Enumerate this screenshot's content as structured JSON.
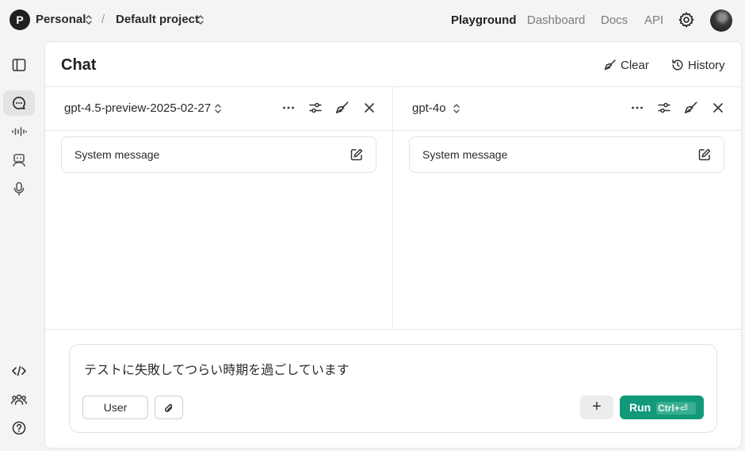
{
  "header": {
    "org_initial": "P",
    "org_name": "Personal",
    "project_name": "Default project",
    "separator": "/",
    "nav": [
      {
        "label": "Playground",
        "active": true
      },
      {
        "label": "Dashboard",
        "active": false
      },
      {
        "label": "Docs",
        "active": false
      },
      {
        "label": "API",
        "active": false
      }
    ],
    "settings_icon": "gear-icon",
    "avatar": "user-avatar"
  },
  "sidebar": {
    "top_items": [
      {
        "icon": "sidebar-toggle-icon"
      },
      {
        "icon": "chat-icon",
        "active": true
      },
      {
        "icon": "audio-waveform-icon"
      },
      {
        "icon": "assistant-robot-icon"
      },
      {
        "icon": "microphone-icon"
      }
    ],
    "bottom_items": [
      {
        "icon": "code-icon"
      },
      {
        "icon": "team-icon"
      },
      {
        "icon": "help-icon"
      }
    ]
  },
  "main": {
    "title": "Chat",
    "actions": {
      "clear_label": "Clear",
      "history_label": "History"
    },
    "columns": [
      {
        "model": "gpt-4.5-preview-2025-02-27",
        "system_message_label": "System message"
      },
      {
        "model": "gpt-4o",
        "system_message_label": "System message"
      }
    ],
    "composer": {
      "message": "テストに失敗してつらい時期を過ごしています",
      "role_label": "User",
      "add_label": "+",
      "run_label": "Run",
      "run_shortcut": "Ctrl+⏎"
    }
  },
  "colors": {
    "accent": "#109a79",
    "background": "#f4f4f4",
    "panel": "#ffffff"
  }
}
